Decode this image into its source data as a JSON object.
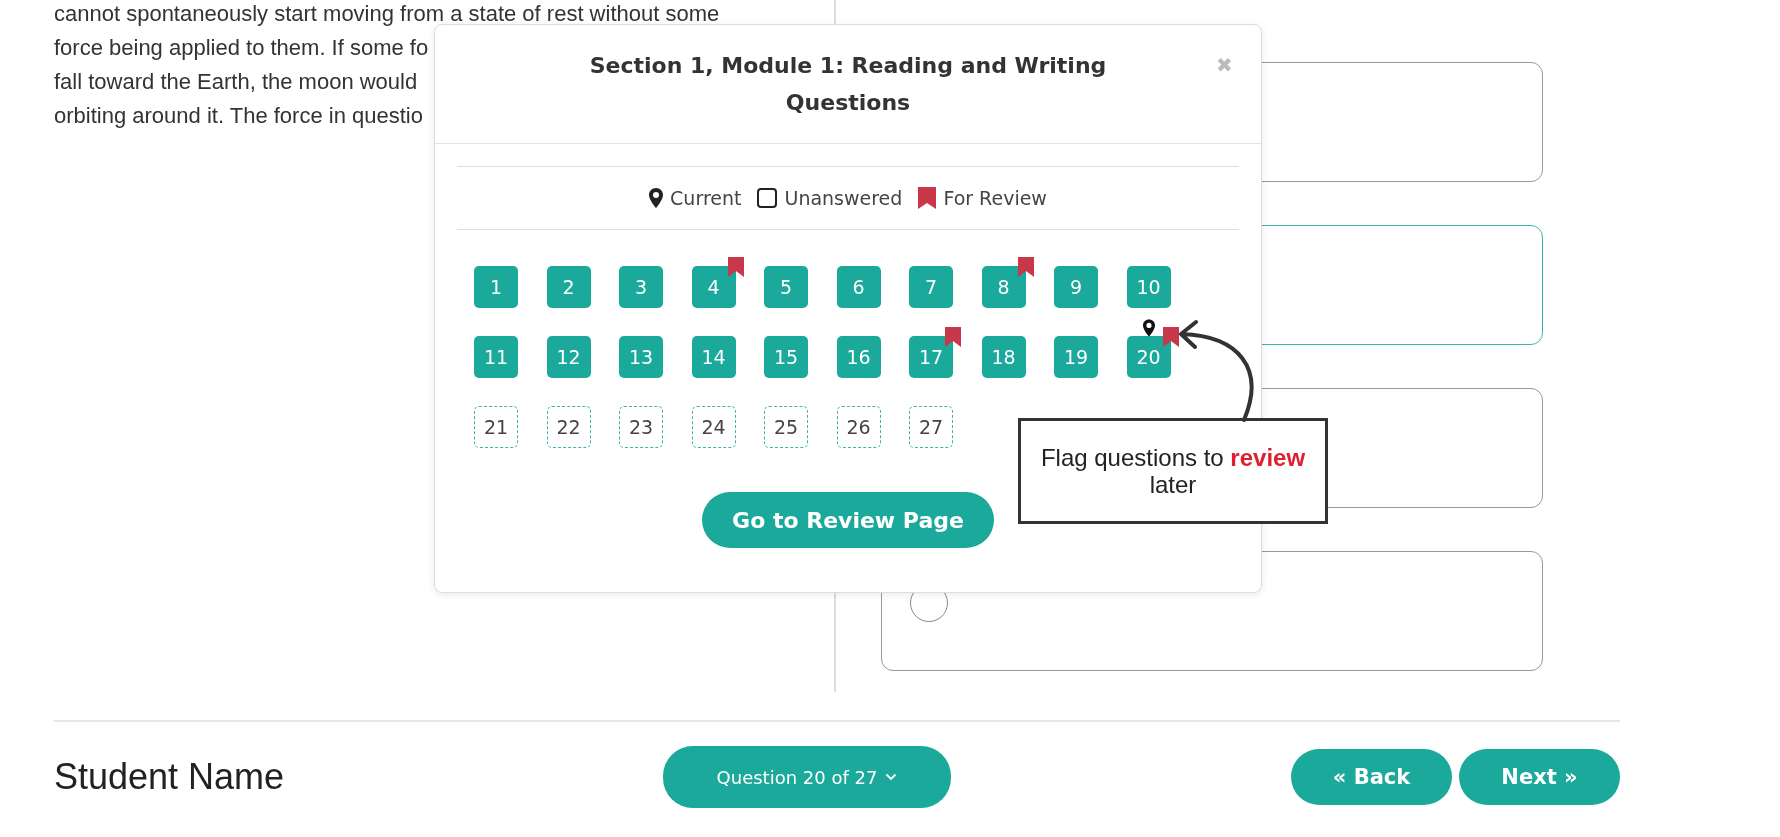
{
  "passage": {
    "lines": [
      "cannot spontaneously start moving from a state of rest without some",
      "force being applied to them. If some fo",
      "fall toward the Earth, the moon would",
      "orbiting around it. The force in questio"
    ]
  },
  "options": [
    {
      "selected": false
    },
    {
      "selected": true
    },
    {
      "selected": false
    },
    {
      "selected": false
    }
  ],
  "modal": {
    "title": "Section 1, Module 1: Reading and Writing Questions",
    "close": "✖",
    "legend": [
      {
        "kind": "current",
        "label": "Current"
      },
      {
        "kind": "unanswered",
        "label": "Unanswered"
      },
      {
        "kind": "review",
        "label": "For Review"
      }
    ],
    "questions": [
      {
        "label": "1",
        "answered": true,
        "flagged": false,
        "current": false
      },
      {
        "label": "2",
        "answered": true,
        "flagged": false,
        "current": false
      },
      {
        "label": "3",
        "answered": true,
        "flagged": false,
        "current": false
      },
      {
        "label": "4",
        "answered": true,
        "flagged": true,
        "current": false
      },
      {
        "label": "5",
        "answered": true,
        "flagged": false,
        "current": false
      },
      {
        "label": "6",
        "answered": true,
        "flagged": false,
        "current": false
      },
      {
        "label": "7",
        "answered": true,
        "flagged": false,
        "current": false
      },
      {
        "label": "8",
        "answered": true,
        "flagged": true,
        "current": false
      },
      {
        "label": "9",
        "answered": true,
        "flagged": false,
        "current": false
      },
      {
        "label": "10",
        "answered": true,
        "flagged": false,
        "current": false
      },
      {
        "label": "11",
        "answered": true,
        "flagged": false,
        "current": false
      },
      {
        "label": "12",
        "answered": true,
        "flagged": false,
        "current": false
      },
      {
        "label": "13",
        "answered": true,
        "flagged": false,
        "current": false
      },
      {
        "label": "14",
        "answered": true,
        "flagged": false,
        "current": false
      },
      {
        "label": "15",
        "answered": true,
        "flagged": false,
        "current": false
      },
      {
        "label": "16",
        "answered": true,
        "flagged": false,
        "current": false
      },
      {
        "label": "17",
        "answered": true,
        "flagged": true,
        "current": false
      },
      {
        "label": "18",
        "answered": true,
        "flagged": false,
        "current": false
      },
      {
        "label": "19",
        "answered": true,
        "flagged": false,
        "current": false
      },
      {
        "label": "20",
        "answered": true,
        "flagged": true,
        "current": true
      },
      {
        "label": "21",
        "answered": false,
        "flagged": false,
        "current": false
      },
      {
        "label": "22",
        "answered": false,
        "flagged": false,
        "current": false
      },
      {
        "label": "23",
        "answered": false,
        "flagged": false,
        "current": false
      },
      {
        "label": "24",
        "answered": false,
        "flagged": false,
        "current": false
      },
      {
        "label": "25",
        "answered": false,
        "flagged": false,
        "current": false
      },
      {
        "label": "26",
        "answered": false,
        "flagged": false,
        "current": false
      },
      {
        "label": "27",
        "answered": false,
        "flagged": false,
        "current": false
      }
    ],
    "button": "Go to Review Page"
  },
  "callout": {
    "text": "Flag questions to **review** later"
  },
  "footer": {
    "student": "Student Name",
    "question_nav": "Question 20 of 27",
    "back": "« Back",
    "next": "Next »"
  }
}
